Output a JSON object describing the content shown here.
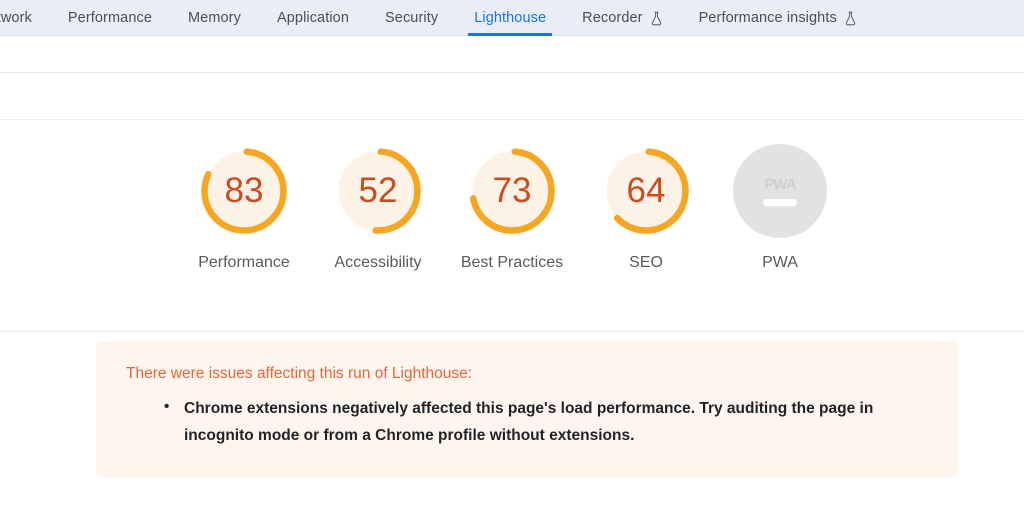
{
  "tabbar": {
    "tabs": [
      {
        "label": "Network",
        "icon": null,
        "active": false,
        "clipped": true
      },
      {
        "label": "Performance",
        "icon": null,
        "active": false
      },
      {
        "label": "Memory",
        "icon": null,
        "active": false
      },
      {
        "label": "Application",
        "icon": null,
        "active": false
      },
      {
        "label": "Security",
        "icon": null,
        "active": false
      },
      {
        "label": "Lighthouse",
        "icon": null,
        "active": true
      },
      {
        "label": "Recorder",
        "icon": "flask-icon",
        "active": false
      },
      {
        "label": "Performance insights",
        "icon": "flask-icon",
        "active": false
      }
    ],
    "active_color": "#1a73e8",
    "inactive_color": "#4b4f56",
    "background": "#e9edf5"
  },
  "scores": {
    "arc_color": "#f5a623",
    "track_color": "#fdf2e6",
    "value_color": "#cc4a1f",
    "label_color": "#5a5a5a",
    "items": [
      {
        "label": "Performance",
        "value": "83",
        "percent": 83
      },
      {
        "label": "Accessibility",
        "value": "52",
        "percent": 52
      },
      {
        "label": "Best Practices",
        "value": "73",
        "percent": 73
      },
      {
        "label": "SEO",
        "value": "64",
        "percent": 64
      }
    ],
    "pwa": {
      "label": "PWA",
      "badge_text": "PWA",
      "badge_color": "#e2e2e2",
      "dash_color": "#ffffff"
    }
  },
  "banner": {
    "heading": "There were issues affecting this run of Lighthouse:",
    "heading_color": "#e4663a",
    "background": "#fef5ee",
    "items": [
      "Chrome extensions negatively affected this page's load performance. Try auditing the page in incognito mode or from a Chrome profile without extensions."
    ]
  }
}
